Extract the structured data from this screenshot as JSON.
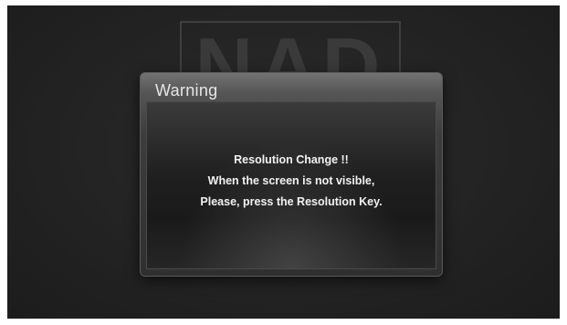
{
  "logo": {
    "text": "NAD"
  },
  "dialog": {
    "title": "Warning",
    "lines": [
      "Resolution Change !!",
      "When the screen is not visible,",
      "Please, press the Resolution Key."
    ]
  },
  "colors": {
    "screen_background": "#232323",
    "dialog_title_text": "#e6e6e6",
    "message_text": "#f2f2f2"
  }
}
